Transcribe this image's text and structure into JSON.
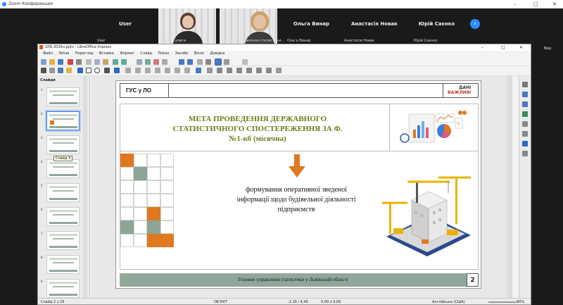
{
  "zoom": {
    "window_title": "Zoom Конференция",
    "participants": [
      {
        "name": "User",
        "label": "User"
      },
      {
        "name": "",
        "label": "Ольга Сулига"
      },
      {
        "name": "",
        "label": "Головне управління статистики..."
      },
      {
        "name": "Ольга Винар",
        "label": "Ольга Винар"
      },
      {
        "name": "Анастасія Новак",
        "label": "Анастасія Новак"
      },
      {
        "name": "Юрій Саєнко",
        "label": "Юрій Саєнко"
      }
    ],
    "next_icon": "chevron-right-icon",
    "view_label": "Вид"
  },
  "impress": {
    "window_title": "1КБ-2026н.pptx - LibreOffice Impress",
    "menu": [
      "Файл",
      "Зміни",
      "Перегляд",
      "Вставка",
      "Формат",
      "Слайд",
      "Показ",
      "Засоби",
      "Вікно",
      "Довідка"
    ],
    "panel_title": "Слайди",
    "thumbnails": [
      "1",
      "2",
      "3",
      "4",
      "5",
      "6",
      "7",
      "8",
      "9"
    ],
    "tooltip": "Слайд 3",
    "status": {
      "slide": "Слайд 2 з 16",
      "object": "ОБ'ЄКТ",
      "position": "-2,16 / 4,45",
      "size": "0,00 x 0,00",
      "language": "Англійська (США)",
      "zoom": "90%"
    }
  },
  "slide": {
    "org": "ГУС у ЛО",
    "logo_line1": "ДАНІ",
    "logo_line2": "ВАЖЛИВІ",
    "title_line1": "МЕТА ПРОВЕДЕННЯ ДЕРЖАВНОГО",
    "title_line2": "СТАТИСТИЧНОГО СПОСТЕРЕЖЕННЯ ЗА Ф.",
    "title_line3": "№1-кб (місячна)",
    "body_line1": "формування оперативної зведеної",
    "body_line2": "інформації щодо будівельної діяльності",
    "body_line3": "підприємств",
    "footer": "Головне управління статистики у Львівській області",
    "number": "2",
    "colors": {
      "orange": "#e0781f",
      "green": "#8da596",
      "title": "#6b7d1a",
      "footer_bg": "#8fa89a"
    }
  }
}
